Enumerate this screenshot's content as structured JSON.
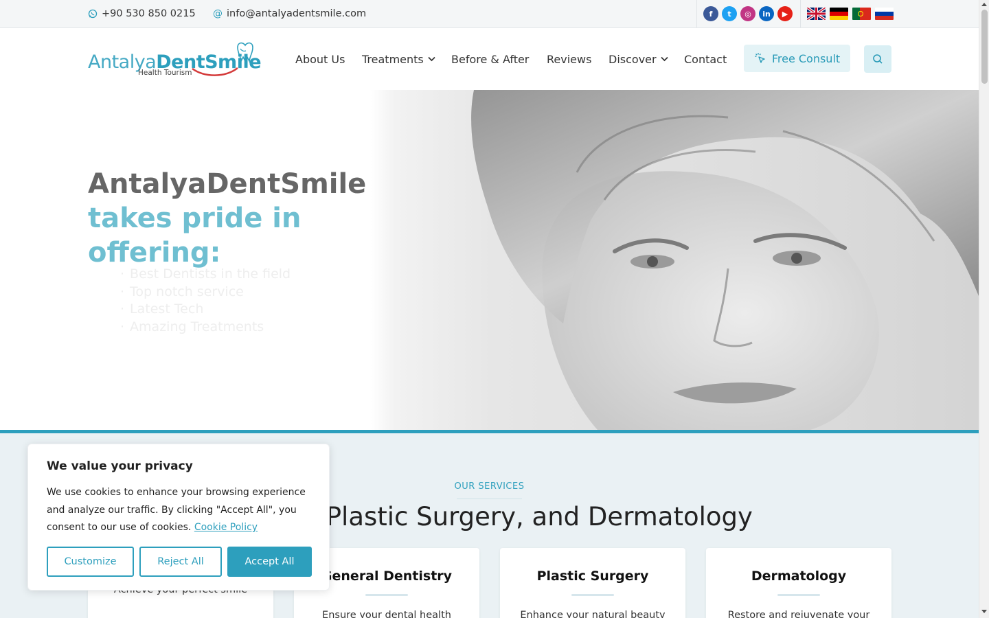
{
  "topbar": {
    "phone": "+90 530 850 0215",
    "email": "info@antalyadentsmile.com",
    "socials": [
      {
        "icon": "facebook-icon",
        "glyph": "f",
        "color": "#3b5998"
      },
      {
        "icon": "twitter-icon",
        "glyph": "t",
        "color": "#1da1f2"
      },
      {
        "icon": "instagram-icon",
        "glyph": "◎",
        "color": "#c13584"
      },
      {
        "icon": "linkedin-icon",
        "glyph": "in",
        "color": "#0a66c2"
      },
      {
        "icon": "youtube-icon",
        "glyph": "▶",
        "color": "#e62117"
      }
    ],
    "languages": [
      "English",
      "Deutsch",
      "Português",
      "Русский"
    ]
  },
  "header": {
    "logo": {
      "part1": "Antalya",
      "part2": "Dent",
      "part3": "Smile",
      "tagline": "Health Tourism"
    },
    "nav": [
      {
        "label": "About Us",
        "dropdown": false
      },
      {
        "label": "Treatments",
        "dropdown": true
      },
      {
        "label": "Before & After",
        "dropdown": false
      },
      {
        "label": "Reviews",
        "dropdown": false
      },
      {
        "label": "Discover",
        "dropdown": true
      },
      {
        "label": "Contact",
        "dropdown": false
      }
    ],
    "consult_label": "Free Consult"
  },
  "hero": {
    "title_line1": "AntalyaDentSmile",
    "title_line2": "takes pride in",
    "title_line3": "offering:",
    "list": [
      "Best Dentists in the field",
      "Top notch service",
      "Latest Tech",
      "Amazing Treatments"
    ]
  },
  "services": {
    "eyebrow": "OUR SERVICES",
    "title": "Dental, Plastic Surgery, and Dermatology",
    "cards": [
      {
        "title": "",
        "text": "Achieve your perfect smile"
      },
      {
        "title": "General Dentistry",
        "text": "Ensure your dental health"
      },
      {
        "title": "Plastic Surgery",
        "text": "Enhance your natural beauty"
      },
      {
        "title": "Dermatology",
        "text": "Restore and rejuvenate your"
      }
    ]
  },
  "cookie": {
    "title": "We value your privacy",
    "text": "We use cookies to enhance your browsing experience and analyze our traffic. By clicking \"Accept All\", you consent to our use of cookies.",
    "link": "Cookie Policy",
    "customize": "Customize",
    "reject": "Reject All",
    "accept": "Accept All"
  },
  "colors": {
    "accent": "#2d9fbd",
    "hero_accent": "#6fbfd1",
    "section_bg": "#eaf1f4"
  }
}
